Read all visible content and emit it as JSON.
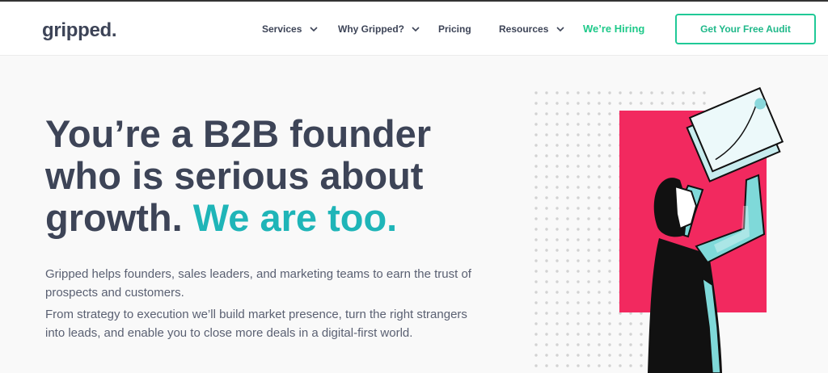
{
  "header": {
    "logo": "gripped.",
    "nav": [
      {
        "label": "Services"
      },
      {
        "label": "Why Gripped?"
      },
      {
        "label": "Pricing"
      },
      {
        "label": "Resources"
      }
    ],
    "hiring": "We’re Hiring",
    "cta": "Get Your Free Audit"
  },
  "hero": {
    "headline_line1": "You’re a B2B founder",
    "headline_line2": "who is serious about",
    "headline_line3_main": "growth.",
    "headline_line3_accent": "We are too.",
    "paragraph1": "Gripped helps founders, sales leaders, and marketing teams to earn the trust of prospects and customers.",
    "paragraph2": "From strategy to execution we’ll build market presence, turn the right strangers into leads, and enable you to close more deals in a digital-first world."
  },
  "colors": {
    "text": "#3d4457",
    "accent_teal": "#1fb5b8",
    "hiring_green": "#1fc98a",
    "illustration_pink": "#f2295f"
  }
}
